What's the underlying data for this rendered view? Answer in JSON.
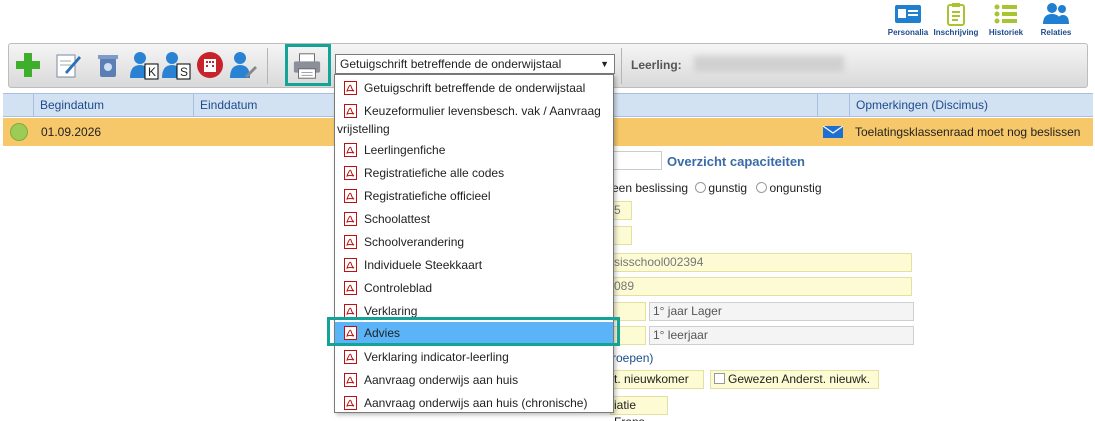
{
  "topnav": {
    "items": [
      {
        "label": "Personalia",
        "icon": "id-card-icon"
      },
      {
        "label": "Inschrijving",
        "icon": "clipboard-icon"
      },
      {
        "label": "Historiek",
        "icon": "list-icon"
      },
      {
        "label": "Relaties",
        "icon": "people-icon"
      }
    ]
  },
  "toolbar": {
    "select_value": "Getuigschrift betreffende de onderwijstaal",
    "leerling_label": "Leerling:",
    "k_label": "K",
    "s_label": "S"
  },
  "table": {
    "headers": [
      "Begindatum",
      "Einddatum",
      "Opmerkingen (Discimus)"
    ],
    "row": {
      "begindatum": "01.09.2026",
      "opmerking": "Toelatingsklassenraad moet nog beslissen"
    }
  },
  "form": {
    "overzicht": "Overzicht capaciteiten",
    "radio_1": "een beslissing",
    "radio_2": "gunstig",
    "radio_3": "ongunstig",
    "field_a": "5",
    "field_school": "sisschool002394",
    "field_num": "089",
    "jaar_lager": "1° jaar Lager",
    "leerjaar": "1° leerjaar",
    "groepen": "roepen)",
    "nieuwkomer": "t. nieuwkomer",
    "gewezen": "Gewezen Anderst. nieuwk.",
    "frans": "iatie Frans"
  },
  "dropdown": {
    "items": [
      "Getuigschrift betreffende de onderwijstaal",
      "Keuzeformulier levensbesch. vak / Aanvraag",
      "vrijstelling",
      "Leerlingenfiche",
      "Registratiefiche alle codes",
      "Registratiefiche officieel",
      "Schoolattest",
      "Schoolverandering",
      "Individuele Steekkaart",
      "Controleblad",
      "Verklaring",
      "Advies",
      "Verklaring indicator-leerling",
      "Aanvraag onderwijs aan huis",
      "Aanvraag onderwijs aan huis (chronische)"
    ],
    "selected": "Advies"
  },
  "colors": {
    "accent": "#14a397",
    "row": "#f7c869",
    "selected": "#5ab4f7",
    "header": "#d3e2f3"
  }
}
